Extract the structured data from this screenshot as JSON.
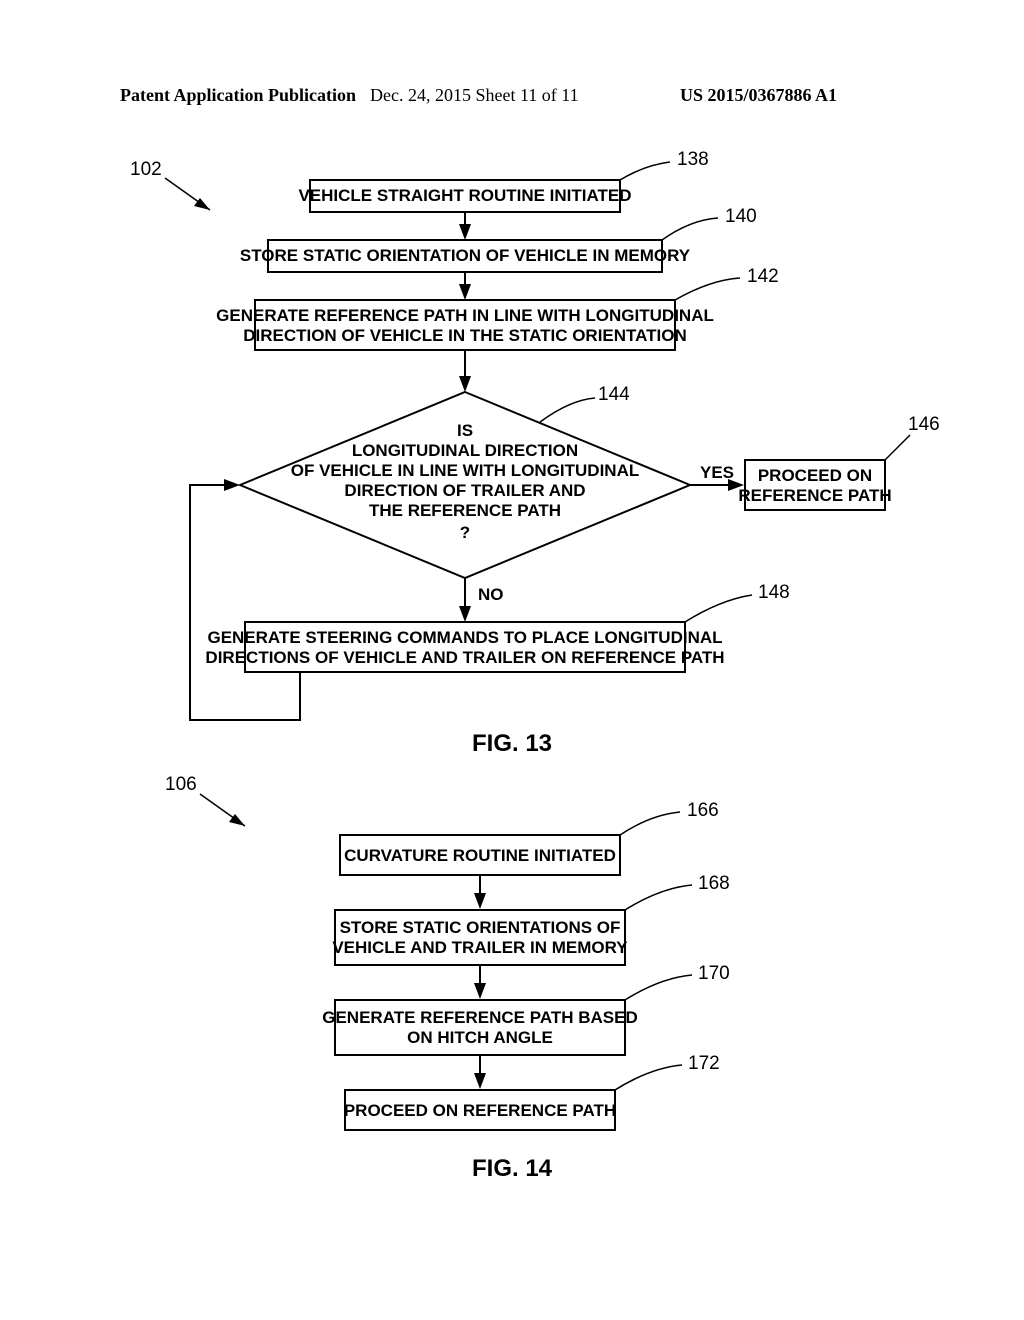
{
  "header": {
    "left": "Patent Application Publication",
    "mid": "Dec. 24, 2015  Sheet 11 of 11",
    "right": "US 2015/0367886 A1"
  },
  "fig13": {
    "ref102": "102",
    "ref138": "138",
    "ref140": "140",
    "ref142": "142",
    "ref144": "144",
    "ref146": "146",
    "ref148": "148",
    "box138": "VEHICLE STRAIGHT ROUTINE INITIATED",
    "box140": "STORE STATIC ORIENTATION OF VEHICLE IN MEMORY",
    "box142_l1": "GENERATE REFERENCE PATH IN LINE WITH LONGITUDINAL",
    "box142_l2": "DIRECTION OF VEHICLE IN THE STATIC ORIENTATION",
    "dec_l1": "IS",
    "dec_l2": "LONGITUDINAL DIRECTION",
    "dec_l3": "OF VEHICLE IN LINE WITH LONGITUDINAL",
    "dec_l4": "DIRECTION OF TRAILER AND",
    "dec_l5": "THE REFERENCE PATH",
    "dec_l6": "?",
    "box146_l1": "PROCEED ON",
    "box146_l2": "REFERENCE PATH",
    "box148_l1": "GENERATE STEERING COMMANDS TO PLACE LONGITUDINAL",
    "box148_l2": "DIRECTIONS OF VEHICLE AND TRAILER ON REFERENCE PATH",
    "yes": "YES",
    "no": "NO",
    "label": "FIG. 13"
  },
  "fig14": {
    "ref106": "106",
    "ref166": "166",
    "ref168": "168",
    "ref170": "170",
    "ref172": "172",
    "box166": "CURVATURE ROUTINE INITIATED",
    "box168_l1": "STORE STATIC ORIENTATIONS OF",
    "box168_l2": "VEHICLE AND TRAILER IN MEMORY",
    "box170_l1": "GENERATE REFERENCE PATH BASED",
    "box170_l2": "ON HITCH ANGLE",
    "box172": "PROCEED ON REFERENCE PATH",
    "label": "FIG. 14"
  }
}
